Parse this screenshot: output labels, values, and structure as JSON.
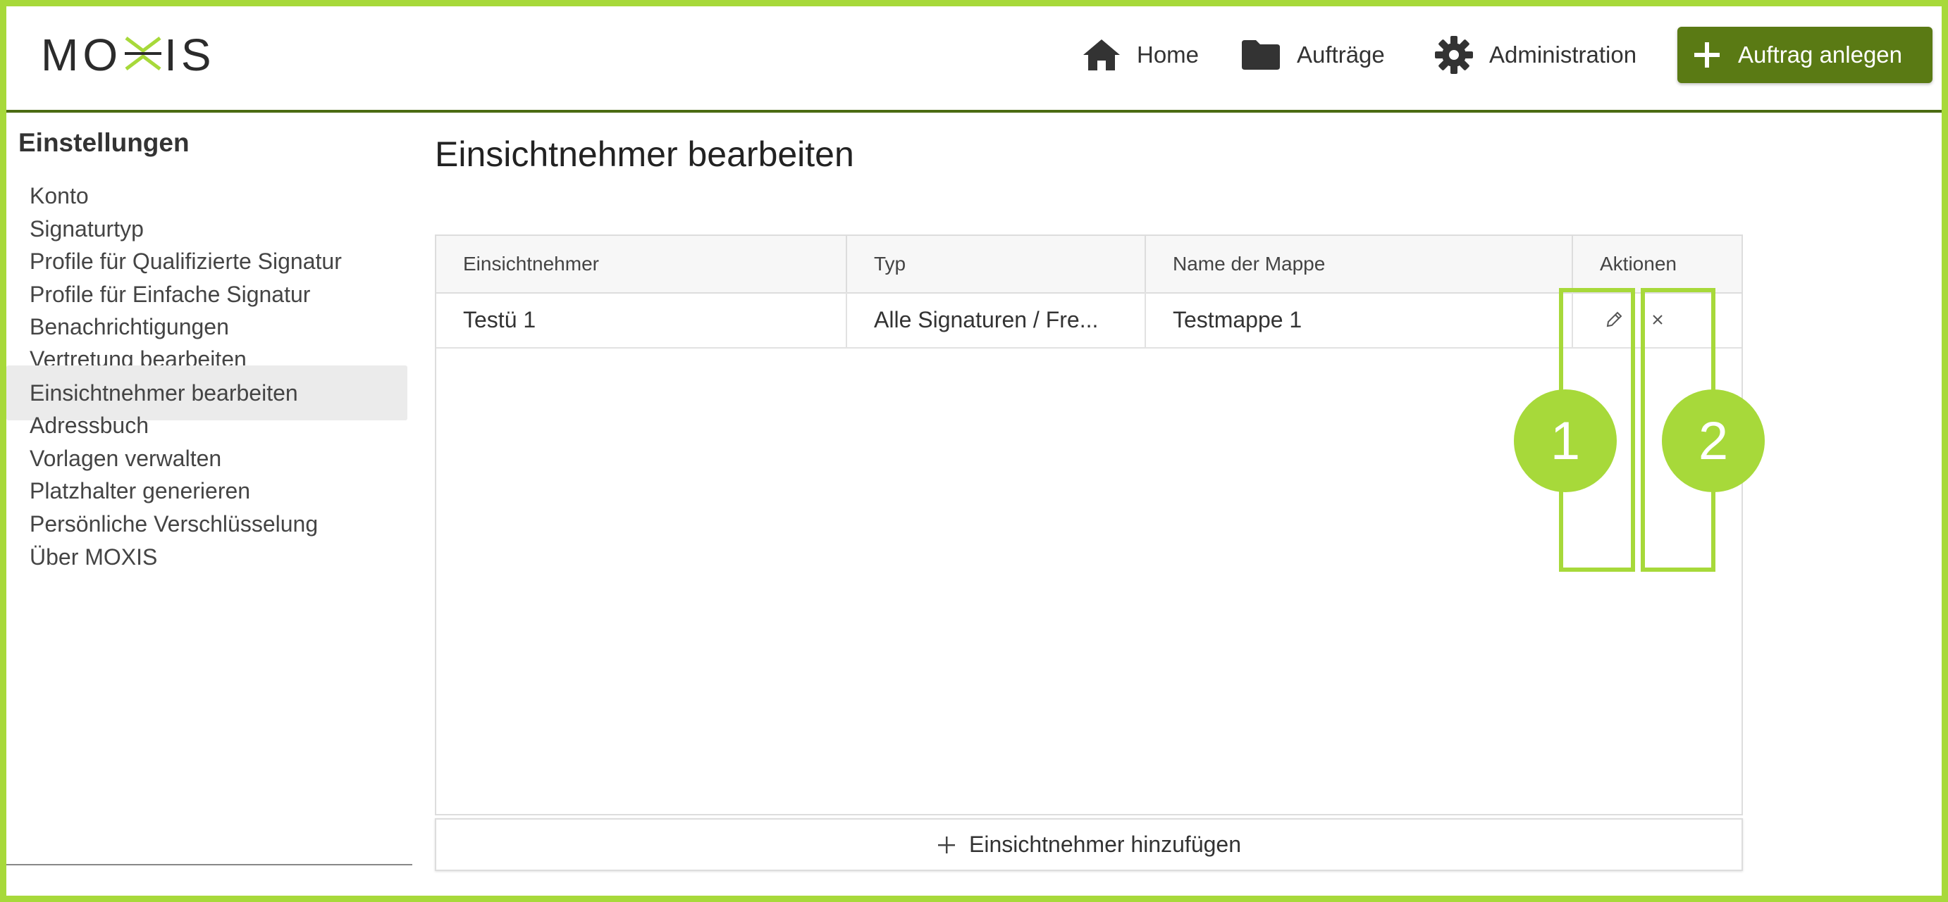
{
  "app": {
    "logo_text": "MOXIS"
  },
  "header": {
    "nav": [
      {
        "label": "Home",
        "icon": "home-icon"
      },
      {
        "label": "Aufträge",
        "icon": "folder-icon"
      },
      {
        "label": "Administration",
        "icon": "gear-icon"
      }
    ],
    "create_button": {
      "label": "Auftrag anlegen",
      "icon": "plus-icon",
      "color": "#5a7a14"
    }
  },
  "sidebar": {
    "title": "Einstellungen",
    "items": [
      {
        "label": "Konto"
      },
      {
        "label": "Signaturtyp"
      },
      {
        "label": "Profile für Qualifizierte Signatur"
      },
      {
        "label": "Profile für Einfache Signatur"
      },
      {
        "label": "Benachrichtigungen"
      },
      {
        "label": "Vertretung bearbeiten"
      },
      {
        "label": "Einsichtnehmer bearbeiten",
        "active": true
      },
      {
        "label": "Adressbuch"
      },
      {
        "label": "Vorlagen verwalten"
      },
      {
        "label": "Platzhalter generieren"
      },
      {
        "label": "Persönliche Verschlüsselung"
      },
      {
        "label": "Über MOXIS"
      }
    ]
  },
  "main": {
    "title": "Einsichtnehmer bearbeiten",
    "table": {
      "columns": [
        "Einsichtnehmer",
        "Typ",
        "Name der Mappe",
        "Aktionen"
      ],
      "rows": [
        {
          "einsichtnehmer": "Testü 1",
          "typ": "Alle Signaturen / Fre...",
          "mappe": "Testmappe 1",
          "actions": [
            "edit-icon",
            "close-icon"
          ]
        }
      ]
    },
    "add_button": {
      "label": "Einsichtnehmer hinzufügen",
      "icon": "plus-icon"
    }
  },
  "annotations": {
    "color": "#a7d93a",
    "callouts": [
      "1",
      "2"
    ]
  }
}
